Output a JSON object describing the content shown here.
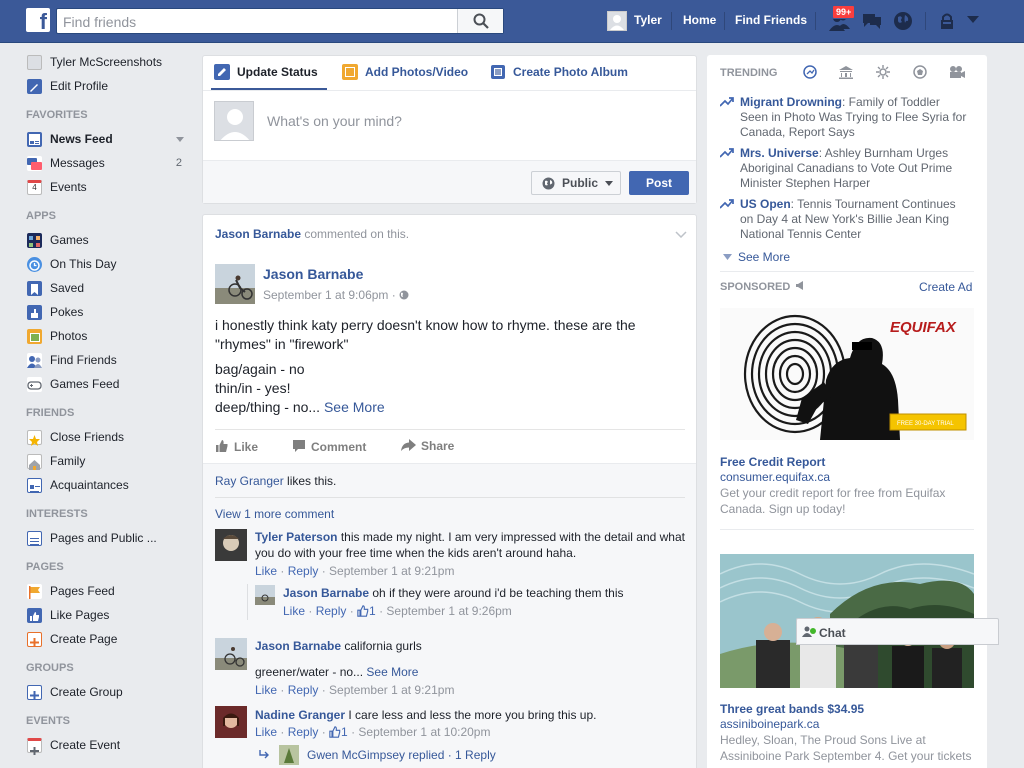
{
  "topbar": {
    "logo": "f",
    "search_placeholder": "Find friends",
    "user_name": "Tyler",
    "home": "Home",
    "find_friends": "Find Friends",
    "notif_count": "99+"
  },
  "left_nav": {
    "profile_name": "Tyler McScreenshots",
    "edit_profile": "Edit Profile",
    "favorites_head": "FAVORITES",
    "news_feed": "News Feed",
    "messages": "Messages",
    "messages_count": "2",
    "events": "Events",
    "apps_head": "APPS",
    "games": "Games",
    "on_this_day": "On This Day",
    "saved": "Saved",
    "pokes": "Pokes",
    "photos": "Photos",
    "find_friends": "Find Friends",
    "games_feed": "Games Feed",
    "friends_head": "FRIENDS",
    "close_friends": "Close Friends",
    "family": "Family",
    "acquaintances": "Acquaintances",
    "interests_head": "INTERESTS",
    "pages_public": "Pages and Public ...",
    "pages_head": "PAGES",
    "pages_feed": "Pages Feed",
    "like_pages": "Like Pages",
    "create_page": "Create Page",
    "groups_head": "GROUPS",
    "create_group": "Create Group",
    "events_head": "EVENTS",
    "create_event": "Create Event"
  },
  "composer": {
    "tab_update": "Update Status",
    "tab_photos": "Add Photos/Video",
    "tab_album": "Create Photo Album",
    "placeholder": "What's on your mind?",
    "privacy": "Public",
    "post": "Post"
  },
  "story": {
    "header_actor": "Jason Barnabe",
    "header_text": " commented on this.",
    "author": "Jason Barnabe",
    "date": "September 1 at 9:06pm · ",
    "line1": "i honestly think katy perry doesn't know how to rhyme. these are the \"rhymes\" in \"firework\"",
    "line2": "bag/again - no",
    "line3": "thin/in - yes!",
    "line4": "deep/thing - no... ",
    "see_more": "See More",
    "like": "Like",
    "comment": "Comment",
    "share": "Share",
    "likes_name": "Ray Granger",
    "likes_text": " likes this.",
    "view_more": "View 1 more comment",
    "c1_name": "Tyler Paterson",
    "c1_text": " this made my night. I am very impressed with the detail and what you do with your free time when the kids aren't around haha.",
    "c1_like": "Like",
    "c1_reply": "Reply",
    "c1_time": " · September 1 at 9:21pm",
    "c1r_name": "Jason Barnabe",
    "c1r_text": " oh if they were around i'd be teaching them this",
    "c1r_like": "Like",
    "c1r_reply": "Reply",
    "c1r_count": "1",
    "c1r_time": " · September 1 at 9:26pm",
    "c2_name": "Jason Barnabe",
    "c2_text": " california gurls",
    "c2_line2": "greener/water - no... ",
    "c2_see_more": "See More",
    "c2_like": "Like",
    "c2_reply": "Reply",
    "c2_time": " · September 1 at 9:21pm",
    "c3_name": "Nadine Granger",
    "c3_text": " I care less and less the more you bring this up.",
    "c3_like": "Like",
    "c3_reply": "Reply",
    "c3_count": "1",
    "c3_time": " · September 1 at 10:20pm",
    "c3_replies": "Gwen McGimpsey replied · 1 Reply"
  },
  "right": {
    "trending_head": "TRENDING",
    "t1_title": "Migrant Drowning",
    "t1_text": ": Family of Toddler Seen in Photo Was Trying to Flee Syria for Canada, Report Says",
    "t2_title": "Mrs. Universe",
    "t2_text": ": Ashley Burnham Urges Aboriginal Canadians to Vote Out Prime Minister Stephen Harper",
    "t3_title": "US Open",
    "t3_text": ": Tennis Tournament Continues on Day 4 at New York's Billie Jean King National Tennis Center",
    "see_more": "See More",
    "sponsored": "SPONSORED",
    "create_ad": "Create Ad",
    "ad1_brand": "EQUIFAX",
    "ad1_badge": "FREE 30-DAY TRIAL",
    "ad1_title": "Free Credit Report",
    "ad1_url": "consumer.equifax.ca",
    "ad1_desc": "Get your credit report for free from Equifax Canada. Sign up today!",
    "ad2_title": "Three great bands $34.95",
    "ad2_url": "assiniboinepark.ca",
    "ad2_desc": "Hedley, Sloan, The Proud Sons Live at Assiniboine Park September 4. Get your tickets",
    "chat": "Chat"
  },
  "colors": {
    "brand_blue": "#3b5998",
    "link": "#365899",
    "notif_red": "#fa3e3e",
    "post_btn": "#4267b2"
  }
}
